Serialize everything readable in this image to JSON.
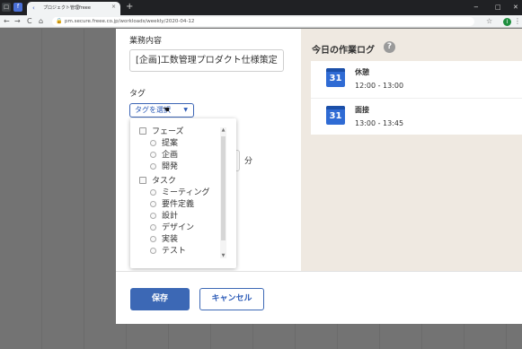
{
  "browser": {
    "pinned_tab_icon": "ロ",
    "freee_tab_icon": "f",
    "active_tab": {
      "title": "プロジェクト管理freee",
      "favicon": "‹"
    },
    "new_tab": "+",
    "window_controls": [
      "−",
      "□",
      "✕"
    ],
    "nav": {
      "back": "←",
      "forward": "→",
      "reload": "C",
      "home": "⌂"
    },
    "url": "pm.secure.freee.co.jp/workloads/weekly/2020-04-12",
    "lock_icon": "🔒",
    "bookmark_icon": "☆",
    "profile_initial": "I",
    "menu_icon": "⋮"
  },
  "form": {
    "task_label": "業務内容",
    "task_value": "[企画]工数管理プロダクト仕様策定",
    "tag_label": "タグ",
    "tag_select_label": "タグを選択",
    "tag_caret": "▼",
    "minutes_unit": "分"
  },
  "tag_dropdown": {
    "groups": [
      {
        "name": "フェーズ",
        "items": [
          "提案",
          "企画",
          "開発"
        ]
      },
      {
        "name": "タスク",
        "items": [
          "ミーティング",
          "要件定義",
          "設計",
          "デザイン",
          "実装",
          "テスト"
        ]
      }
    ],
    "scroll_up": "▲",
    "scroll_down": "▼"
  },
  "work_log": {
    "title": "今日の作業ログ",
    "help": "?",
    "calendar_day": "31",
    "entries": [
      {
        "name": "休憩",
        "time": "12:00 - 13:00"
      },
      {
        "name": "面接",
        "time": "13:00 - 13:45"
      }
    ]
  },
  "buttons": {
    "save": "保存",
    "cancel": "キャンセル"
  },
  "colors": {
    "primary": "#3c68b5",
    "calendar": "#2f6bd4",
    "log_panel_bg": "#efe9e1"
  }
}
